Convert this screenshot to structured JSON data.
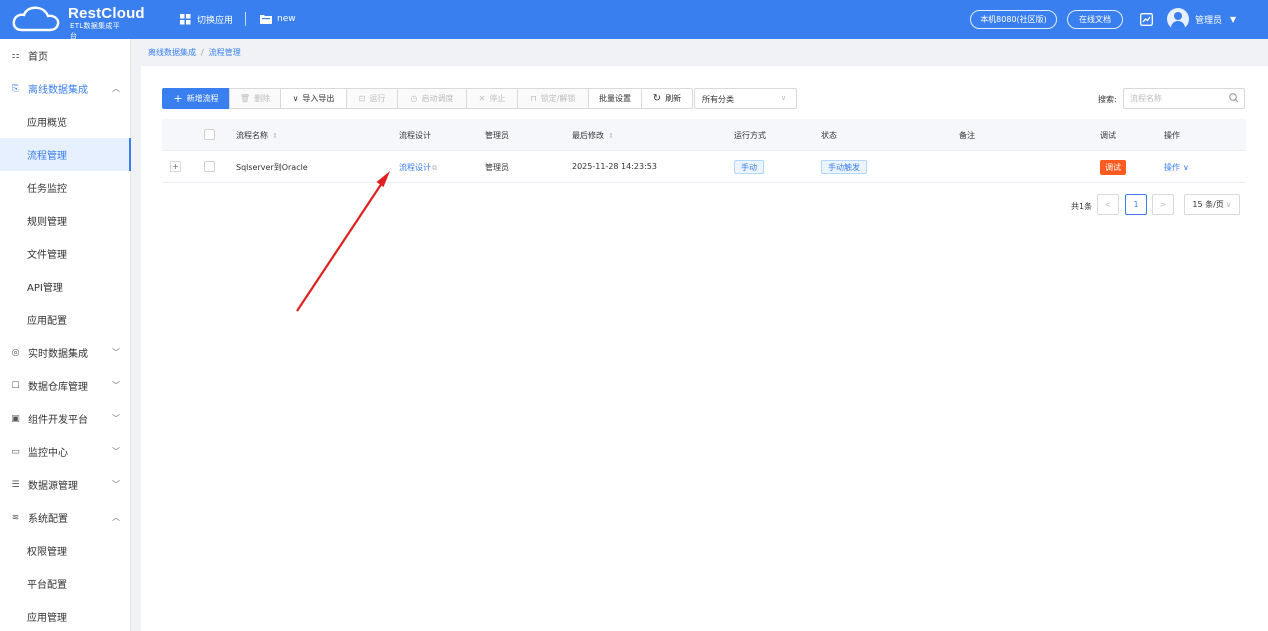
{
  "header": {
    "logo_title": "RestCloud",
    "logo_subtitle": "ETL数据集成平台",
    "switch_app": "切换应用",
    "app_name": "new",
    "env_pill": "本机8080(社区版)",
    "docs_pill": "在线文档",
    "user_name": "管理员",
    "brand_color": "#3a7ff0"
  },
  "sidebar": {
    "home": "首页",
    "offline_group": "离线数据集成",
    "offline_items": [
      "应用概览",
      "流程管理",
      "任务监控",
      "规则管理",
      "文件管理",
      "API管理",
      "应用配置"
    ],
    "realtime_group": "实时数据集成",
    "warehouse_group": "数据仓库管理",
    "component_group": "组件开发平台",
    "monitor_group": "监控中心",
    "datasource_group": "数据源管理",
    "system_group": "系统配置",
    "system_items": [
      "权限管理",
      "平台配置",
      "应用管理"
    ]
  },
  "breadcrumb": [
    "离线数据集成",
    "流程管理"
  ],
  "toolbar": {
    "new_flow": "新增流程",
    "delete": "删除",
    "import_export": "导入导出",
    "run": "运行",
    "start_schedule": "启动调度",
    "stop": "停止",
    "lock_unlock": "锁定/解锁",
    "batch_settings": "批量设置",
    "refresh": "刷新",
    "category_value": "所有分类",
    "search_label": "搜索:",
    "search_placeholder": "流程名称"
  },
  "table": {
    "headers": {
      "name": "流程名称",
      "design": "流程设计",
      "admin": "管理员",
      "modified": "最后修改",
      "run_mode": "运行方式",
      "status": "状态",
      "remark": "备注",
      "debug": "调试",
      "action": "操作"
    },
    "rows": [
      {
        "name": "Sqlserver到Oracle",
        "design": "流程设计",
        "admin": "管理员",
        "modified": "2025-11-28 14:23:53",
        "run_mode": "手动",
        "status": "手动触发",
        "remark": "",
        "debug": "调试",
        "action": "操作"
      }
    ]
  },
  "pagination": {
    "total": "共1条",
    "current_page": "1",
    "page_size": "15 条/页"
  },
  "annotation": {
    "arrow_color": "#e02020"
  }
}
